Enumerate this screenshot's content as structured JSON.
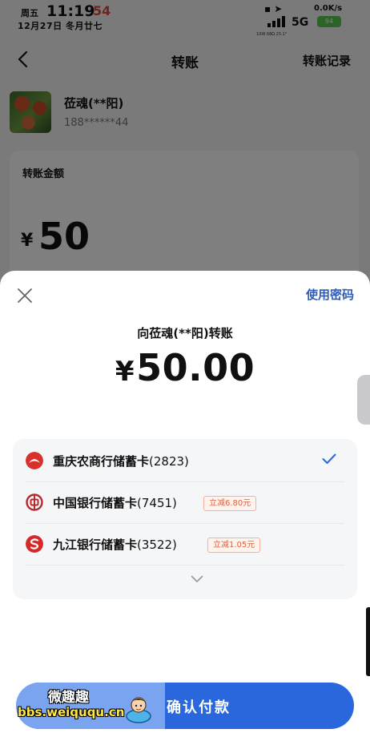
{
  "status_bar": {
    "weekday": "周五",
    "time": "11:19",
    "seconds": "54",
    "date": "12月27日 冬月廿七",
    "network": "5G",
    "speed": "0.0K/s",
    "battery": "94",
    "mini_text": "10W  68Ω   25.1°"
  },
  "nav": {
    "title": "转账",
    "right_link": "转账记录"
  },
  "payee": {
    "name": "莅魂(**阳)",
    "phone": "188******44"
  },
  "amount_card": {
    "label": "转账金额",
    "currency": "¥",
    "value": "50"
  },
  "sheet": {
    "use_password": "使用密码",
    "title": "向莅魂(**阳)转账",
    "currency": "¥",
    "amount": "50.00",
    "cards": [
      {
        "name": "重庆农商行储蓄卡",
        "number": "(2823)",
        "promo": "",
        "selected": true,
        "icon": "cqrcb-logo-icon",
        "color": "#d8312b"
      },
      {
        "name": "中国银行储蓄卡",
        "number": "(7451)",
        "promo": "立减6.80元",
        "selected": false,
        "icon": "boc-logo-icon",
        "color": "#b8292f"
      },
      {
        "name": "九江银行储蓄卡",
        "number": "(3522)",
        "promo": "立减1.05元",
        "selected": false,
        "icon": "jjccb-logo-icon",
        "color": "#d42a2a"
      }
    ],
    "confirm": "确认付款"
  },
  "watermark": {
    "cn": "微趣趣",
    "url": "bbs.weiququ.cn"
  },
  "colors": {
    "accent_blue": "#2b67dc",
    "password_link": "#2d5db8",
    "check": "#2b67dc",
    "promo": "#e0623f"
  }
}
